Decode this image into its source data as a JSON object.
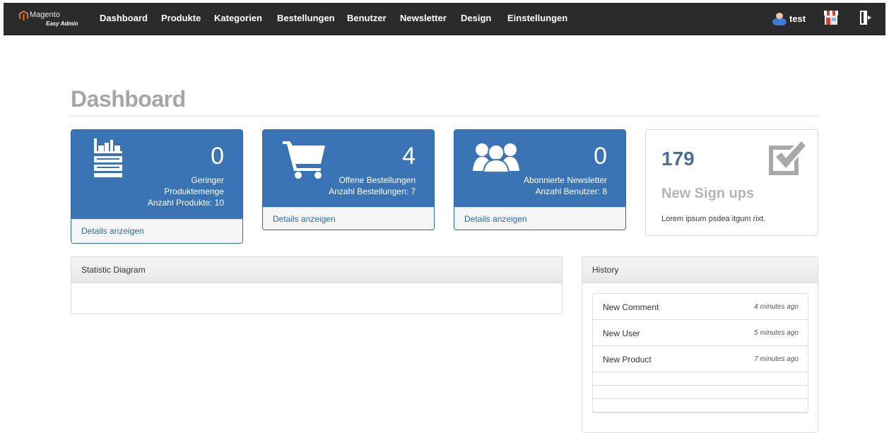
{
  "brand": {
    "name": "Magento",
    "sub": "Easy Admin"
  },
  "nav": {
    "items": [
      "Dashboard",
      "Produkte",
      "Kategorien",
      "Bestellungen",
      "Benutzer",
      "Newsletter",
      "Design",
      "Einstellungen"
    ],
    "user": "test"
  },
  "page": {
    "title": "Dashboard"
  },
  "cards": [
    {
      "count": "0",
      "line1": "Geringer",
      "line2": "Produktemenge",
      "line3": "Anzahl Produkte: 10",
      "link": "Details anzeigen",
      "icon": "warehouse-icon"
    },
    {
      "count": "4",
      "line1": "Offene Bestellungen",
      "line2": "Anzahl Bestellungen: 7",
      "link": "Details anzeigen",
      "icon": "cart-icon"
    },
    {
      "count": "0",
      "line1": "Abonnierte Newsletter",
      "line2": "Anzahl Benutzer: 8",
      "link": "Details anzeigen",
      "icon": "users-icon"
    }
  ],
  "signups": {
    "count": "179",
    "label": "New Sign ups",
    "text": "Lorem ipsum psdea itgum rixt.",
    "icon": "checkbox-icon"
  },
  "statistic": {
    "title": "Statistic Diagram"
  },
  "history": {
    "title": "History",
    "items": [
      {
        "title": "New Comment",
        "time": "4 minutes ago"
      },
      {
        "title": "New User",
        "time": "5 minutes ago"
      },
      {
        "title": "New Product",
        "time": "7 minutes ago"
      }
    ]
  },
  "colors": {
    "navbar": "#2b2b2b",
    "card_blue": "#3a74b4",
    "link": "#2e6aa8",
    "title_gray": "#a6a6a6"
  }
}
